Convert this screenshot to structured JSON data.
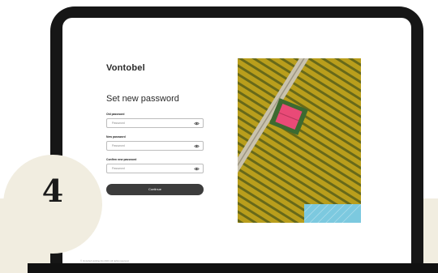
{
  "step_number": "4",
  "app": {
    "logo": "Vontobel",
    "title": "Set new password",
    "fields": [
      {
        "label": "Old password",
        "placeholder": "Password"
      },
      {
        "label": "New password",
        "placeholder": "Password"
      },
      {
        "label": "Confirm new password",
        "placeholder": "Password"
      }
    ],
    "continue_label": "Continue",
    "footer": "© Vontobel Holding AG 2023. All rights reserved."
  },
  "colors": {
    "accent_band": "#f1ede0",
    "laptop_frame": "#161616",
    "button": "#3c3c3c",
    "photo_overlay": "#7cc9df"
  },
  "icons": [
    "eye-icon"
  ]
}
